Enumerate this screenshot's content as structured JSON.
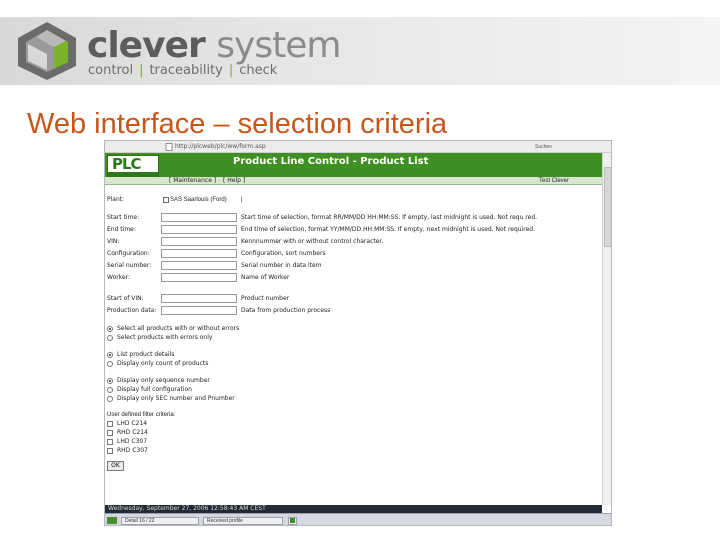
{
  "brand": {
    "word_primary": "clever",
    "word_secondary": "system",
    "tagline": [
      "control",
      "traceability",
      "check"
    ],
    "colors": {
      "gray": "#5c5c5c",
      "green": "#7ab228",
      "title_orange": "#c8561b"
    }
  },
  "slide": {
    "title": "Web interface – selection criteria"
  },
  "browser": {
    "address": "http://plcweb/plc/ww/form.asp",
    "right_label": "Suchen"
  },
  "app": {
    "logo_text": "PLC",
    "title": "Product Line Control - Product List",
    "menu": [
      "[ Maintenance ]",
      "[ Help ]"
    ],
    "user": "Test Clever",
    "banner_color": "#3f8f23"
  },
  "form": {
    "plant": {
      "label": "Plant:",
      "value": "SAS Saarlouis (Ford)",
      "description": "|"
    },
    "fields": [
      {
        "label": "Start time:",
        "description": "Start time of selection, format RR/MM/DD HH:MM:SS. If empty, last midnight is used. Not requ red."
      },
      {
        "label": "End time:",
        "description": "End time of selection, format YY/MM/DD HH:MM:SS. If empty, next midnight is used. Not required."
      },
      {
        "label": "VIN:",
        "description": "Kennnummer with or without control character."
      },
      {
        "label": "Configuration:",
        "description": "Configuration, sort numbers"
      },
      {
        "label": "Serial number:",
        "description": "Serial number in data item"
      },
      {
        "label": "Worker:",
        "description": "Name of Worker"
      }
    ],
    "fields2": [
      {
        "label": "Start of VIN:",
        "description": "Product number"
      },
      {
        "label": "Production data:",
        "description": "Data from production process"
      }
    ],
    "group1": [
      {
        "label": "Select all products with or without errors",
        "checked": true
      },
      {
        "label": "Select products with errors only",
        "checked": false
      }
    ],
    "group2": [
      {
        "label": "List product details",
        "checked": true
      },
      {
        "label": "Display only count of products",
        "checked": false
      }
    ],
    "group3": [
      {
        "label": "Display only sequence number",
        "checked": true
      },
      {
        "label": "Display full configuration",
        "checked": false
      },
      {
        "label": "Display only SEC number and Pnumber",
        "checked": false
      }
    ],
    "filter_heading": "User defined filter criteria:",
    "filters": [
      "LHD C214",
      "RHD C214",
      "LHD C307",
      "RHD C307"
    ],
    "ok_label": "OK"
  },
  "statusbar": {
    "text": "Wednesday, September 27, 2006 12:58:43 AM CEST"
  },
  "taskbar": {
    "tabs": [
      "Detail 16 / 22",
      "Received profile"
    ]
  }
}
